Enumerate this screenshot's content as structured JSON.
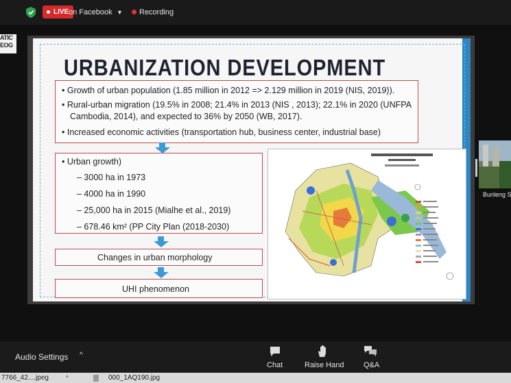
{
  "toolbar": {
    "live_label": "LIVE",
    "stream_target": "on Facebook",
    "recording_label": "Recording"
  },
  "left_panel": {
    "line1": "ATIC",
    "line2": "EOG"
  },
  "slide": {
    "title": "URBANIZATION DEVELOPMENT",
    "bullets_top": [
      "• Growth of urban population (1.85 million in 2012 => 2.129 million in 2019 (NIS, 2019)).",
      "• Rural-urban migration (19.5% in 2008; 21.4% in 2013 (NIS , 2013); 22.1% in 2020 (UNFPA",
      "Cambodia, 2014), and expected to 36% by 2050 (WB, 2017).",
      "• Increased economic activities (transportation hub, business center, industrial base)"
    ],
    "growth_heading": "• Urban growth)",
    "growth_items": [
      "– 3000 ha in 1973",
      "– 4000 ha in 1990",
      "– 25,000 ha in 2015 (Mialhe et al., 2019)",
      "– 678.46 km² (PP City Plan (2018-2030)"
    ],
    "box3": "Changes in urban morphology",
    "box4": "UHI phenomenon"
  },
  "participant": {
    "name": "Bunleng S"
  },
  "controls": {
    "audio_settings": "Audio Settings",
    "chat": "Chat",
    "raise_hand": "Raise Hand",
    "qa": "Q&A"
  },
  "downloads": {
    "file1": "7766_42....jpeg",
    "file2": "000_1AQ190.jpg"
  },
  "icons": {
    "shield": "shield-icon",
    "caret": "chevron-down-icon",
    "record_dot": "record-dot-icon",
    "chat": "chat-bubble-icon",
    "hand": "raise-hand-icon",
    "qa": "qa-bubbles-icon",
    "arrow": "down-arrow-icon"
  },
  "colors": {
    "live": "#d62b2b",
    "accent_blue": "#2c87c4",
    "box_border": "#c24a4a",
    "arrow_blue": "#3b9bd6"
  }
}
